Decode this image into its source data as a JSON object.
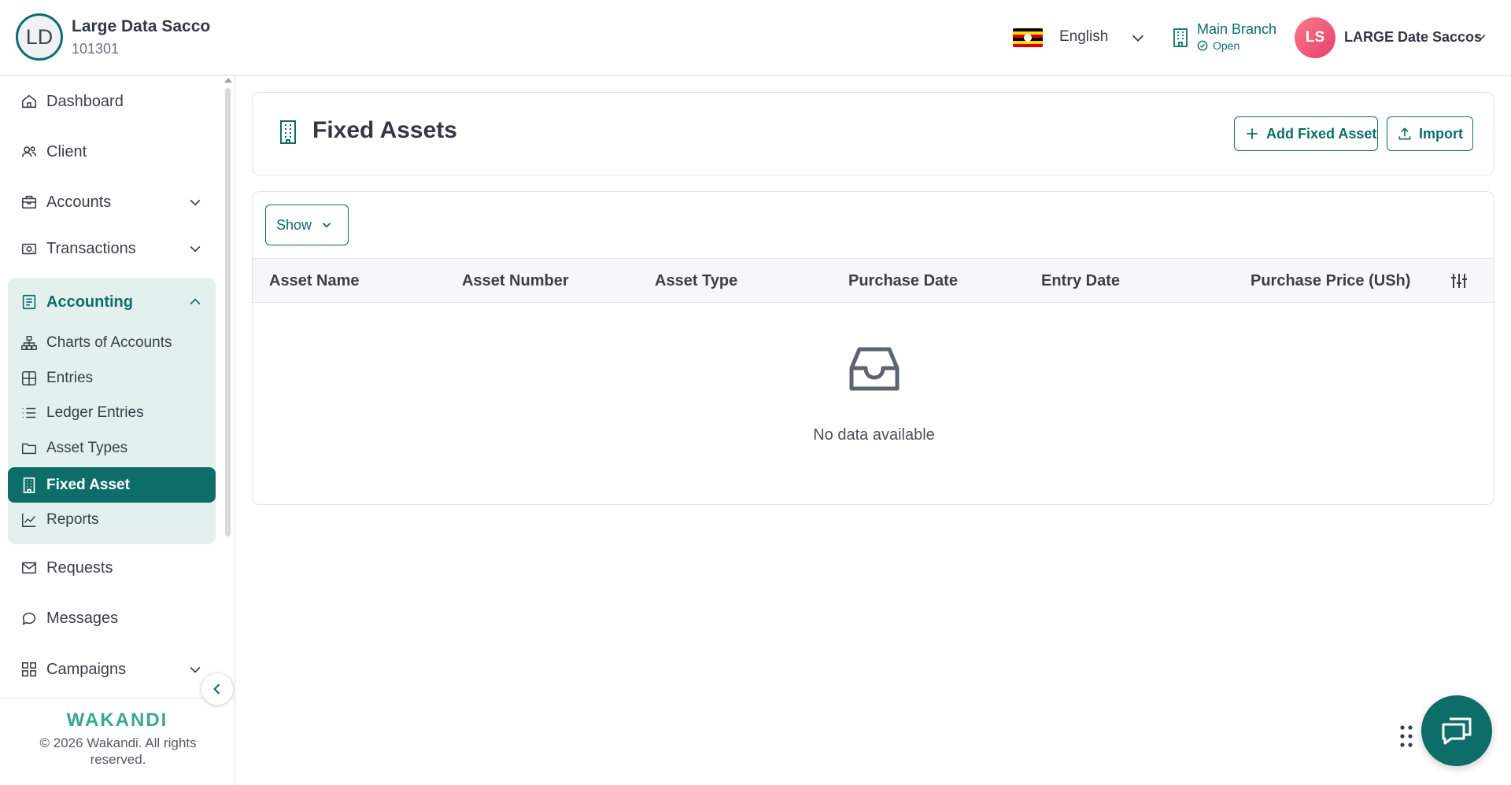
{
  "header": {
    "org_initials": "LD",
    "org_name": "Large Data Sacco",
    "org_code": "101301",
    "language": "English",
    "branch_name": "Main Branch",
    "branch_status": "Open",
    "user_initials": "LS",
    "user_name": "LARGE Date Saccos"
  },
  "sidebar": {
    "items": [
      {
        "label": "Dashboard",
        "icon": "home-icon"
      },
      {
        "label": "Client",
        "icon": "users-icon"
      },
      {
        "label": "Accounts",
        "icon": "briefcase-icon"
      },
      {
        "label": "Transactions",
        "icon": "cash-icon"
      },
      {
        "label": "Accounting",
        "icon": "ledger-icon"
      },
      {
        "label": "Requests",
        "icon": "mail-icon"
      },
      {
        "label": "Messages",
        "icon": "chat-icon"
      },
      {
        "label": "Campaigns",
        "icon": "grid-icon"
      }
    ],
    "accounting_sub": [
      {
        "label": "Charts of Accounts",
        "icon": "hierarchy-icon"
      },
      {
        "label": "Entries",
        "icon": "table-icon"
      },
      {
        "label": "Ledger Entries",
        "icon": "list-icon"
      },
      {
        "label": "Asset Types",
        "icon": "folder-icon"
      },
      {
        "label": "Fixed Asset",
        "icon": "building-icon"
      },
      {
        "label": "Reports",
        "icon": "chart-icon"
      }
    ],
    "active_item": "Fixed Asset",
    "footer": {
      "brand": "WAKANDI",
      "copyright": "© 2026 Wakandi. All rights reserved."
    }
  },
  "main": {
    "title": "Fixed Assets",
    "add_button": "Add Fixed Asset",
    "import_button": "Import",
    "show_button": "Show",
    "columns": [
      "Asset Name",
      "Asset Number",
      "Asset Type",
      "Purchase Date",
      "Entry Date",
      "Purchase Price (USh)"
    ],
    "empty_message": "No data available"
  },
  "colors": {
    "primary": "#0d6e69",
    "accounting_bg": "#e3f0ee",
    "brand": "#3aa693",
    "avatar": "#ea3e6b"
  }
}
